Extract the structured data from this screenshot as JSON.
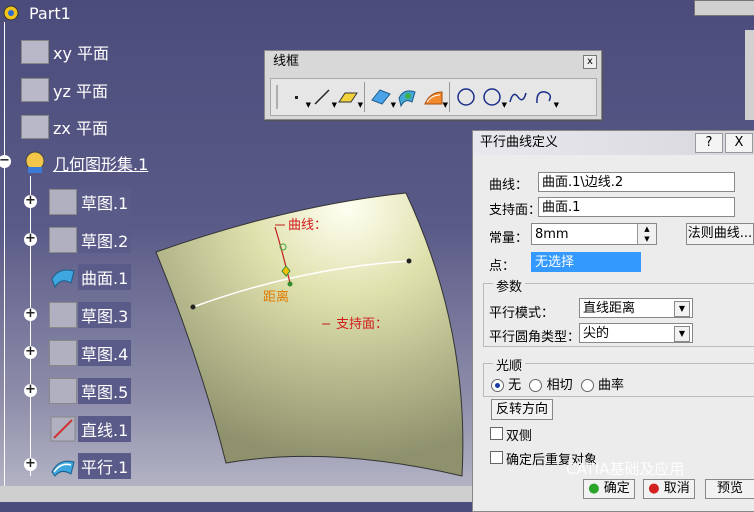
{
  "tree": {
    "root": "Part1",
    "items": [
      {
        "label": "xy 平面",
        "icon": "plane-icon"
      },
      {
        "label": "yz 平面",
        "icon": "plane-icon"
      },
      {
        "label": "zx 平面",
        "icon": "plane-icon"
      },
      {
        "label": "几何图形集.1",
        "icon": "geometrical-set-icon"
      },
      {
        "label": "草图.1",
        "icon": "sketch-icon"
      },
      {
        "label": "草图.2",
        "icon": "sketch-icon"
      },
      {
        "label": "曲面.1",
        "icon": "surface-icon"
      },
      {
        "label": "草图.3",
        "icon": "sketch-icon"
      },
      {
        "label": "草图.4",
        "icon": "sketch-icon"
      },
      {
        "label": "草图.5",
        "icon": "sketch-icon"
      },
      {
        "label": "直线.1",
        "icon": "line-icon"
      },
      {
        "label": "平行.1",
        "icon": "parallel-curve-icon"
      }
    ]
  },
  "toolbar": {
    "title": "线框",
    "close": "x"
  },
  "viewport": {
    "curve_label": "曲线：",
    "distance_label": "距离",
    "support_label": "支持面：",
    "surface_color": "#d6d8a4"
  },
  "dialog": {
    "title": "平行曲线定义",
    "help": "?",
    "close": "X",
    "curve_label": "曲线：",
    "curve_value": "曲面.1\\边线.2",
    "support_label": "支持面：",
    "support_value": "曲面.1",
    "constant_label": "常量：",
    "constant_value": "8mm",
    "law_button": "法则曲线...",
    "point_label": "点：",
    "point_value": "无选择",
    "params_group": "参数",
    "parallel_mode_label": "平行模式：",
    "parallel_mode_value": "直线距离",
    "corner_type_label": "平行圆角类型：",
    "corner_type_value": "尖的",
    "smoothing_group": "光顺",
    "smooth_none": "无",
    "smooth_tangent": "相切",
    "smooth_curvature": "曲率",
    "reverse_button": "反转方向",
    "both_sides": "双侧",
    "repeat_object": "确定后重复对象",
    "ok_button": "确定",
    "cancel_button": "取消",
    "preview_button": "预览",
    "accent": "#3399ff"
  },
  "watermark": "CATIA基础及应用"
}
